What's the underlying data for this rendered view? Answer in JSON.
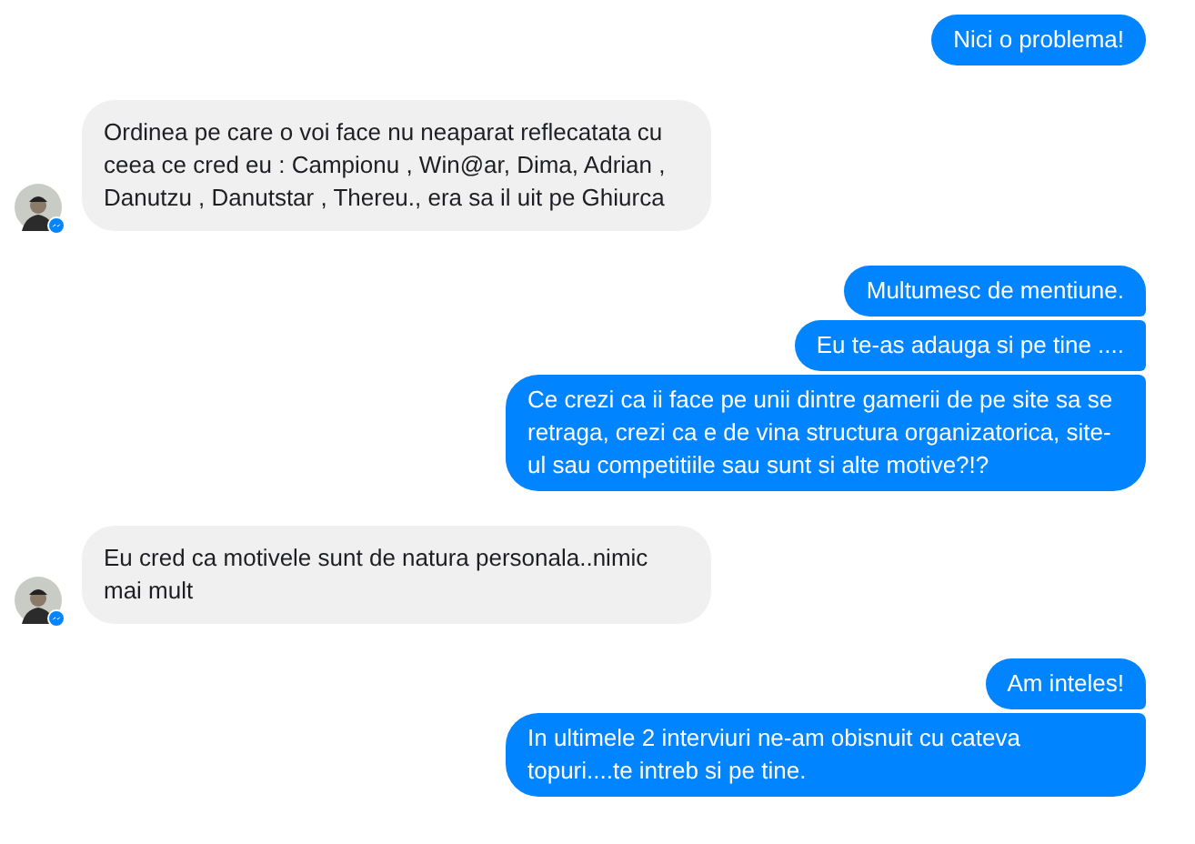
{
  "messages": [
    {
      "kind": "sent",
      "bubbles": [
        "Nici o problema!"
      ]
    },
    {
      "kind": "received",
      "bubbles": [
        "Ordinea pe care o voi face nu neaparat reflecatata cu ceea ce cred eu :  Campionu , Win@ar, Dima, Adrian , Danutzu , Danutstar , Thereu., era sa il uit pe Ghiurca"
      ]
    },
    {
      "kind": "sent",
      "bubbles": [
        "Multumesc de mentiune.",
        "Eu te-as adauga si pe tine ....",
        "Ce crezi ca ii face pe unii dintre gamerii de pe site sa se retraga, crezi ca e de vina structura organizatorica, site-ul sau competitiile sau sunt si alte motive?!?"
      ]
    },
    {
      "kind": "received",
      "bubbles": [
        "Eu cred ca motivele sunt de natura personala..nimic mai mult"
      ]
    },
    {
      "kind": "sent",
      "bubbles": [
        "Am inteles!",
        "In ultimele 2 interviuri ne-am obisnuit cu cateva topuri....te intreb si pe tine."
      ]
    }
  ]
}
